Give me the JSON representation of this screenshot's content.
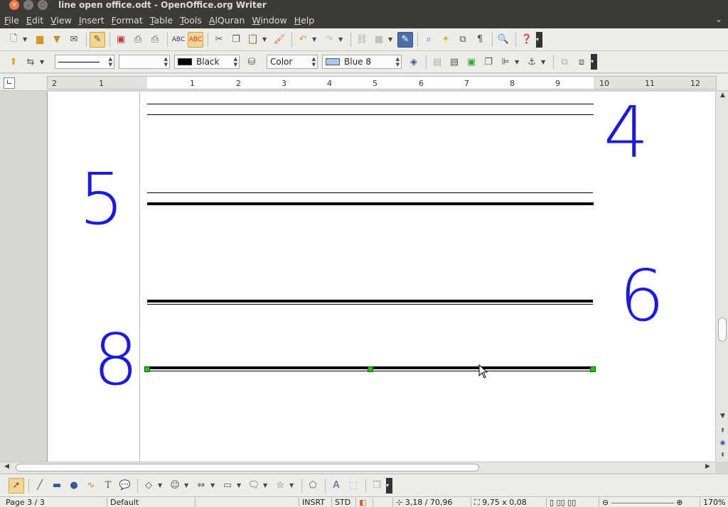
{
  "window": {
    "title": "line open office.odt - OpenOffice.org Writer",
    "close_symbol": "×",
    "min_symbol": "⌄",
    "max_symbol": "○"
  },
  "menu": {
    "items": [
      "File",
      "Edit",
      "View",
      "Insert",
      "Format",
      "Table",
      "Tools",
      "AlQuran",
      "Window",
      "Help"
    ]
  },
  "formatting": {
    "line_color": "Black",
    "area_style": "Color",
    "area_color": "Blue 8",
    "line_color_hex": "#000000",
    "area_color_hex": "#a8c8ec"
  },
  "ruler": {
    "labels": [
      "2",
      "1",
      "1",
      "2",
      "3",
      "4",
      "5",
      "6",
      "7",
      "8",
      "9",
      "10",
      "11",
      "12"
    ]
  },
  "document": {
    "annotations": [
      "4",
      "5",
      "6",
      "8"
    ],
    "annotation_color": "#1a1ae6"
  },
  "status": {
    "page": "Page 3 / 3",
    "style": "Default",
    "insert_mode": "INSRT",
    "selection_mode": "STD",
    "position": "3,18 / 70,96",
    "size": "9,75 x 0,08",
    "zoom": "170%"
  }
}
